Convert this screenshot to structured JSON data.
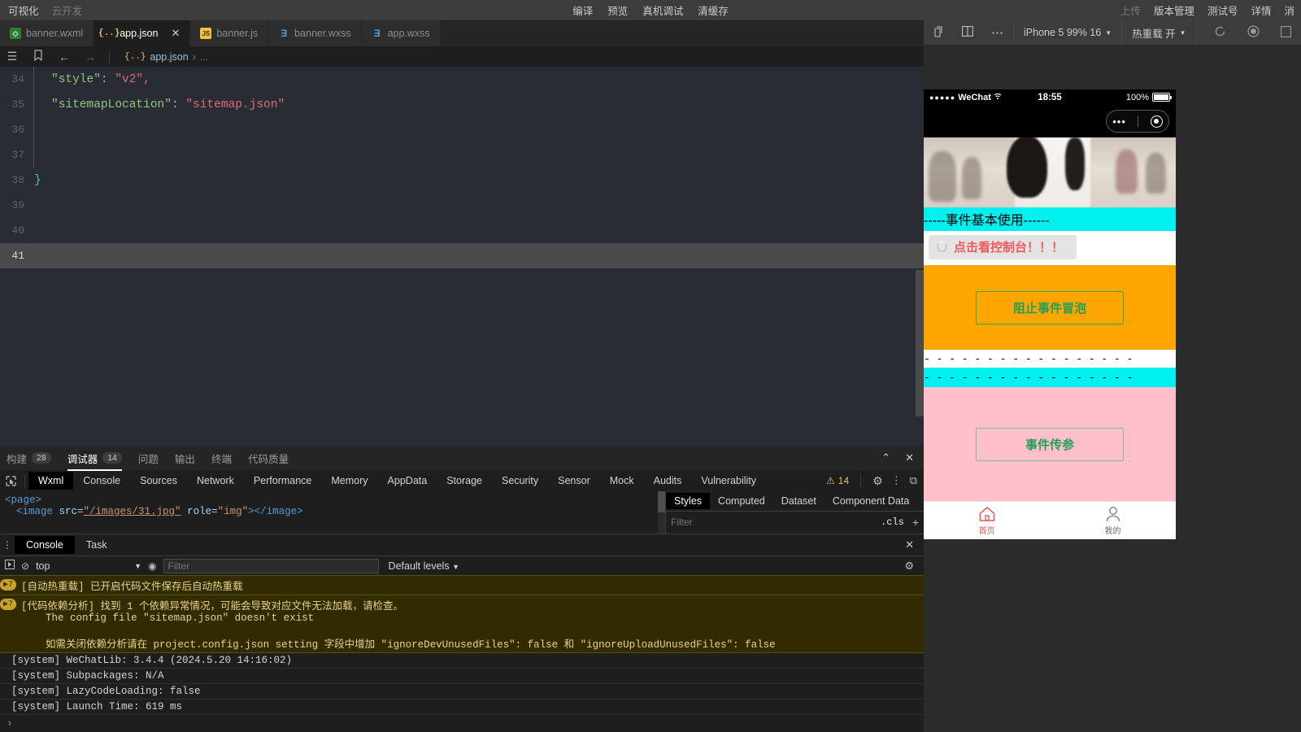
{
  "topbar": {
    "left": [
      {
        "label": "可视化",
        "dim": false
      },
      {
        "label": "云开发",
        "dim": true
      }
    ],
    "center": [
      {
        "label": "编译"
      },
      {
        "label": "预览"
      },
      {
        "label": "真机调试"
      },
      {
        "label": "清缓存"
      }
    ],
    "right": [
      {
        "label": "上传",
        "dim": true
      },
      {
        "label": "版本管理",
        "dim": false
      },
      {
        "label": "测试号",
        "dim": false
      },
      {
        "label": "详情",
        "dim": false
      },
      {
        "label": "消",
        "dim": false
      }
    ]
  },
  "tabs": [
    {
      "label": "banner.wxml",
      "icon": "wxml-file-icon",
      "icon_text": "◇",
      "icon_class": "ic-wxml",
      "active": false,
      "closable": false
    },
    {
      "label": "app.json",
      "icon": "json-file-icon",
      "icon_text": "{..}",
      "icon_class": "ic-json",
      "active": true,
      "closable": true,
      "close": "✕"
    },
    {
      "label": "banner.js",
      "icon": "js-file-icon",
      "icon_text": "JS",
      "icon_class": "ic-js",
      "active": false,
      "closable": false
    },
    {
      "label": "banner.wxss",
      "icon": "wxss-file-icon",
      "icon_text": "Ǝ",
      "icon_class": "ic-wxss",
      "active": false,
      "closable": false
    },
    {
      "label": "app.wxss",
      "icon": "wxss-file-icon",
      "icon_text": "Ǝ",
      "icon_class": "ic-wxss",
      "active": false,
      "closable": false
    }
  ],
  "breadcrumb": {
    "menu_icon": "☰",
    "bookmark_icon": "🔖",
    "back_icon": "←",
    "forward_icon": "→",
    "json_icon": "{..}",
    "file": "app.json",
    "separator": "›",
    "more": "..."
  },
  "editor": {
    "lines": [
      {
        "num": "34",
        "segments": [
          {
            "t": "\"style\"",
            "c": "k-str"
          },
          {
            "t": ": ",
            "c": "k-punc"
          },
          {
            "t": "\"v2\"",
            "c": "k-val"
          },
          {
            "t": ",",
            "c": "k-val"
          }
        ],
        "indent": true,
        "current": false
      },
      {
        "num": "35",
        "segments": [
          {
            "t": "\"sitemapLocation\"",
            "c": "k-str"
          },
          {
            "t": ": ",
            "c": "k-punc"
          },
          {
            "t": "\"sitemap.json\"",
            "c": "k-val"
          }
        ],
        "indent": true,
        "current": false
      },
      {
        "num": "36",
        "segments": [],
        "indent": true,
        "current": false
      },
      {
        "num": "37",
        "segments": [],
        "indent": true,
        "current": false
      },
      {
        "num": "38",
        "segments": [
          {
            "t": "}",
            "c": "k-brace"
          }
        ],
        "indent": false,
        "current": false,
        "nopad": true
      },
      {
        "num": "39",
        "segments": [],
        "indent": false,
        "current": false
      },
      {
        "num": "40",
        "segments": [],
        "indent": false,
        "current": false
      },
      {
        "num": "41",
        "segments": [],
        "indent": false,
        "current": true
      }
    ]
  },
  "devtools": {
    "panels": [
      {
        "label": "构建",
        "badge": "28",
        "active": false
      },
      {
        "label": "调试器",
        "badge": "14",
        "active": true
      },
      {
        "label": "问题",
        "badge": null,
        "active": false
      },
      {
        "label": "输出",
        "badge": null,
        "active": false
      },
      {
        "label": "终端",
        "badge": null,
        "active": false
      },
      {
        "label": "代码质量",
        "badge": null,
        "active": false
      }
    ],
    "window_buttons": [
      {
        "icon": "collapse-icon",
        "glyph": "⌃"
      },
      {
        "icon": "close-icon",
        "glyph": "✕"
      }
    ],
    "inspect_icon": "▣",
    "tabs": [
      {
        "label": "Wxml",
        "active": true
      },
      {
        "label": "Console",
        "active": false
      },
      {
        "label": "Sources",
        "active": false
      },
      {
        "label": "Network",
        "active": false
      },
      {
        "label": "Performance",
        "active": false
      },
      {
        "label": "Memory",
        "active": false
      },
      {
        "label": "AppData",
        "active": false
      },
      {
        "label": "Storage",
        "active": false
      },
      {
        "label": "Security",
        "active": false
      },
      {
        "label": "Sensor",
        "active": false
      },
      {
        "label": "Mock",
        "active": false
      },
      {
        "label": "Audits",
        "active": false
      },
      {
        "label": "Vulnerability",
        "active": false
      }
    ],
    "warning_glyph": "⚠",
    "warning_count": "14",
    "gear_glyph": "⚙",
    "kebab_glyph": "⋮",
    "dock_glyph": "⧉",
    "wxml": {
      "line1_tag_open": "<page>",
      "line2": [
        {
          "t": "<image",
          "c": "tg"
        },
        {
          "t": " src=",
          "c": "at"
        },
        {
          "t": "\"/images/31.jpg\"",
          "c": "sv"
        },
        {
          "t": " role=",
          "c": "at"
        },
        {
          "t": "\"img\"",
          "c": "sv2"
        },
        {
          "t": ">",
          "c": "tg"
        },
        {
          "t": "</image>",
          "c": "tg"
        }
      ]
    },
    "styles": {
      "tabs": [
        {
          "label": "Styles",
          "active": true
        },
        {
          "label": "Computed",
          "active": false
        },
        {
          "label": "Dataset",
          "active": false
        },
        {
          "label": "Component Data",
          "active": false
        }
      ],
      "filter_placeholder": "Filter",
      "cls_label": ".cls",
      "plus_glyph": "+"
    }
  },
  "console": {
    "kebab_glyph": "⋮",
    "tabs": [
      {
        "label": "Console",
        "active": true
      },
      {
        "label": "Task",
        "active": false
      }
    ],
    "close_glyph": "✕",
    "toolbar": {
      "exec_glyph": "▶|",
      "clear_glyph": "⊘",
      "context": "top",
      "eye_glyph": "◉",
      "filter_placeholder": "Filter",
      "levels": "Default levels",
      "gear_glyph": "⚙"
    },
    "logs": [
      {
        "type": "warn",
        "badge": "▶7",
        "text": "[自动热重载] 已开启代码文件保存后自动热重载"
      },
      {
        "type": "warn",
        "badge": "▶7",
        "text": "[代码依赖分析] 找到 1 个依赖异常情况，可能会导致对应文件无法加载，请检查。\n    The config file \"sitemap.json\" doesn't exist\n\n    如需关闭依赖分析请在 project.config.json setting 字段中增加 \"ignoreDevUnusedFiles\": false 和 \"ignoreUploadUnusedFiles\": false"
      },
      {
        "type": "plain",
        "text": "[system] WeChatLib: 3.4.4 (2024.5.20 14:16:02)"
      },
      {
        "type": "plain",
        "text": "[system] Subpackages: N/A"
      },
      {
        "type": "plain",
        "text": "[system] LazyCodeLoading: false"
      },
      {
        "type": "plain",
        "text": "[system] Launch Time: 619 ms"
      }
    ],
    "prompt_glyph": "›"
  },
  "simulator": {
    "toolbar": {
      "copy_glyph": "⧉",
      "split_glyph": "◫",
      "more_glyph": "⋯",
      "device": "iPhone 5 99% 16",
      "hotreload": "热重载 开",
      "refresh_glyph": "⟳",
      "record_glyph": "◉",
      "dock_glyph": "▯"
    },
    "phone": {
      "status": {
        "signal_dots": "●●●●●",
        "carrier": "WeChat",
        "wifi_glyph": "⇞",
        "time": "18:55",
        "battery_pct": "100%"
      },
      "capsule": {
        "dots": "•••",
        "target": "target-icon"
      },
      "banner_alt": "street-photo-banner",
      "section_title": "-----事件基本使用------",
      "console_button": "点击看控制台！！！",
      "stop_bubble_button": "阻止事件冒泡",
      "dash_white": "- - - - - - - - - - - - - - - - -",
      "dash_cyan": "- - - - - - - - - - - - - - - - -",
      "event_param_button": "事件传参",
      "tabbar": [
        {
          "label": "首页",
          "icon": "home-icon",
          "active": true
        },
        {
          "label": "我的",
          "icon": "person-icon",
          "active": false
        }
      ]
    }
  },
  "colors": {
    "accent_cyan": "#00f0f0",
    "accent_orange": "#ffa500",
    "accent_pink": "#ffc0cb",
    "green_text": "#22a05a",
    "red_text": "#f05a5a",
    "tab_active_red": "#e05a5a"
  }
}
